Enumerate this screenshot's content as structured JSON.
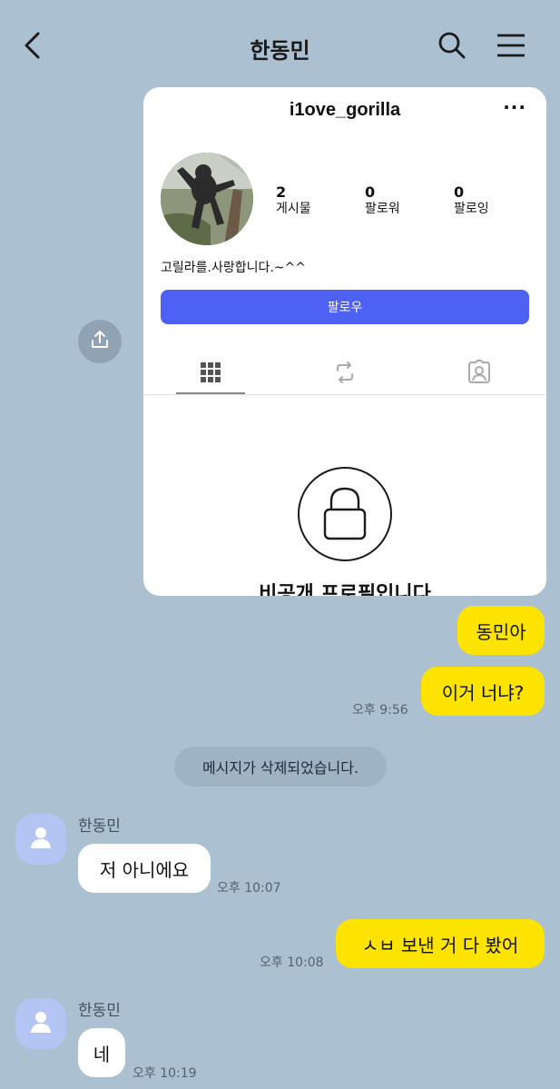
{
  "header": {
    "title": "한동민",
    "back_icon": "chevron-left-icon",
    "search_icon": "search-icon",
    "menu_icon": "hamburger-menu-icon"
  },
  "shared_image": {
    "username": "i1ove_gorilla",
    "more": "···",
    "stats": [
      {
        "num": "2",
        "label": "게시물"
      },
      {
        "num": "0",
        "label": "팔로워"
      },
      {
        "num": "0",
        "label": "팔로잉"
      }
    ],
    "bio": "고릴라를.사랑합니다.~^^",
    "follow_label": "팔로우",
    "private_text": "비공개 프로필입니다"
  },
  "messages": [
    {
      "kind": "me",
      "text": "동민아"
    },
    {
      "kind": "me",
      "text": "이거 너냐?",
      "time": "오후 9:56"
    },
    {
      "kind": "system",
      "text": "메시지가 삭제되었습니다."
    },
    {
      "kind": "them",
      "sender": "한동민",
      "text": "저 아니에요",
      "time": "오후 10:07"
    },
    {
      "kind": "me",
      "text": "ㅅㅂ 보낸 거 다 봤어",
      "time": "오후 10:08"
    },
    {
      "kind": "them",
      "sender": "한동민",
      "text": "네",
      "time": "오후 10:19"
    }
  ],
  "colors": {
    "background": "#abc1d1",
    "my_bubble": "#fde300",
    "their_bubble": "#ffffff",
    "follow_button": "#4d62f5"
  }
}
